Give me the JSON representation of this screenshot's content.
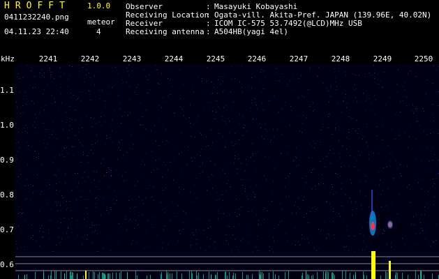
{
  "app": {
    "title": "HROFFT",
    "version": "1.0.0",
    "filename": "0411232240.png",
    "datetime": "04.11.23 22:40",
    "meteor_label": "meteor",
    "meteor_count": "4"
  },
  "info": [
    {
      "key": "Observer",
      "sep": ":",
      "value": "Masayuki Kobayashi"
    },
    {
      "key": "Receiving Location",
      "sep": ":",
      "value": "Ogata-vill. Akita-Pref. JAPAN (139.96E, 40.02N)"
    },
    {
      "key": "Receiver",
      "sep": ":",
      "value": "ICOM IC-575 53.7492(@LCD)MHz USB"
    },
    {
      "key": "Receiving antenna",
      "sep": ":",
      "value": "A504HB(yagi 4el)"
    }
  ],
  "axis": {
    "unit": "kHz",
    "time_ticks": [
      "2241",
      "2242",
      "2243",
      "2244",
      "2245",
      "2246",
      "2247",
      "2248",
      "2249",
      "2250"
    ],
    "freq_ticks": [
      "1.1",
      "1.0",
      "0.9",
      "0.8",
      "0.7",
      "0.6"
    ]
  },
  "colors": {
    "title": "#ffff00",
    "background": "#000000",
    "noise": "#1a1a66",
    "echo_core": "#ff3355",
    "echo_halo": "#00aaff",
    "signal": "#ffff00"
  }
}
